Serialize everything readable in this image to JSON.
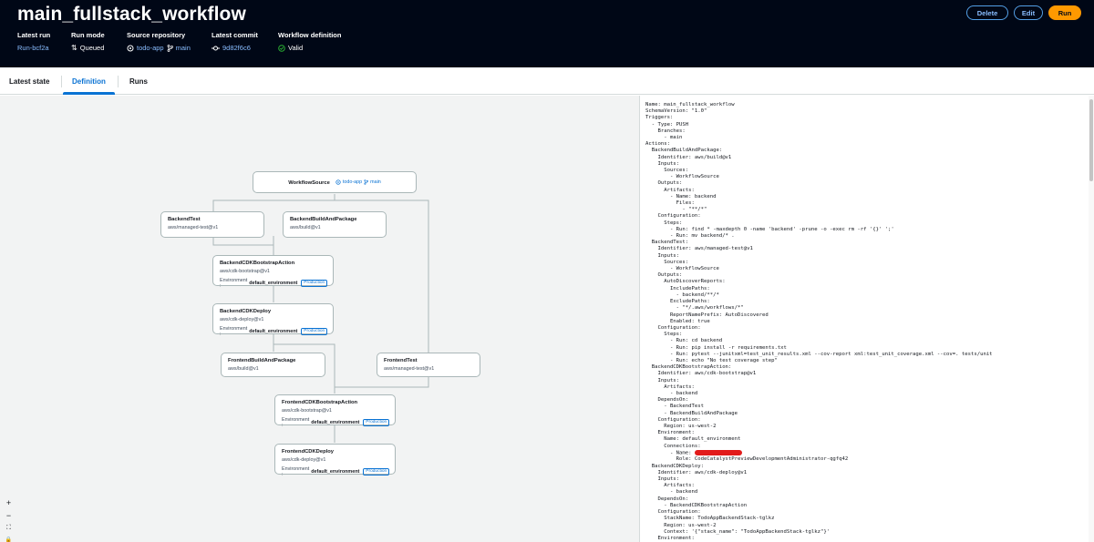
{
  "workflow": {
    "title": "main_fullstack_workflow",
    "latest_run": {
      "label": "Latest run",
      "value": "Run-bcf2a"
    },
    "run_mode": {
      "label": "Run mode",
      "value": "Queued"
    },
    "source_repository": {
      "label": "Source repository",
      "repo": "todo-app",
      "branch": "main"
    },
    "latest_commit": {
      "label": "Latest commit",
      "value": "9d82f6c6"
    },
    "workflow_definition": {
      "label": "Workflow definition",
      "value": "Valid"
    }
  },
  "actions": {
    "delete": "Delete",
    "edit": "Edit",
    "run": "Run"
  },
  "tabs": [
    "Latest state",
    "Definition",
    "Runs"
  ],
  "graph": {
    "source": {
      "name": "WorkflowSource",
      "repo": "todo-app",
      "branch": "main"
    },
    "env_label": "Environment :",
    "nodes": [
      {
        "name": "BackendTest",
        "id": "aws/managed-test@v1"
      },
      {
        "name": "BackendBuildAndPackage",
        "id": "aws/build@v1"
      },
      {
        "name": "BackendCDKBootstrapAction",
        "id": "aws/cdk-bootstrap@v1",
        "env": "default_environment",
        "badge": "Production"
      },
      {
        "name": "BackendCDKDeploy",
        "id": "aws/cdk-deploy@v1",
        "env": "default_environment",
        "badge": "Production"
      },
      {
        "name": "FrontendBuildAndPackage",
        "id": "aws/build@v1"
      },
      {
        "name": "FrontendTest",
        "id": "aws/managed-test@v1"
      },
      {
        "name": "FrontendCDKBootstrapAction",
        "id": "aws/cdk-bootstrap@v1",
        "env": "default_environment",
        "badge": "Production"
      },
      {
        "name": "FrontendCDKDeploy",
        "id": "aws/cdk-deploy@v1",
        "env": "default_environment",
        "badge": "Production"
      }
    ],
    "zoom_controls": [
      "+",
      "−",
      "⛶",
      "🔒"
    ]
  },
  "yaml_pre": "Name: main_fullstack_workflow\nSchemaVersion: \"1.0\"\nTriggers:\n  - Type: PUSH\n    Branches:\n      - main\nActions:\n  BackendBuildAndPackage:\n    Identifier: aws/build@v1\n    Inputs:\n      Sources:\n        - WorkflowSource\n    Outputs:\n      Artifacts:\n        - Name: backend\n          Files:\n            - \"**/*\"\n    Configuration:\n      Steps:\n        - Run: find * -maxdepth 0 -name 'backend' -prune -o -exec rm -rf '{}' ';'\n        - Run: mv backend/* .\n  BackendTest:\n    Identifier: aws/managed-test@v1\n    Inputs:\n      Sources:\n        - WorkflowSource\n    Outputs:\n      AutoDiscoverReports:\n        IncludePaths:\n          - backend/**/*\n        ExcludePaths:\n          - \"*/.aws/workflows/*\"\n        ReportNamePrefix: AutoDiscovered\n        Enabled: true\n    Configuration:\n      Steps:\n        - Run: cd backend\n        - Run: pip install -r requirements.txt\n        - Run: pytest --junitxml=test_unit_results.xml --cov-report xml:test_unit_coverage.xml --cov=. tests/unit\n        - Run: echo \"No test coverage step\"\n  BackendCDKBootstrapAction:\n    Identifier: aws/cdk-bootstrap@v1\n    Inputs:\n      Artifacts:\n        - backend\n    DependsOn:\n      - BackendTest\n      - BackendBuildAndPackage\n    Configuration:\n      Region: us-west-2\n    Environment:\n      Name: default_environment\n      Connections:\n        - Name: ",
  "yaml_post": "\n          Role: CodeCatalystPreviewDevelopmentAdministrator-qgfq42\n  BackendCDKDeploy:\n    Identifier: aws/cdk-deploy@v1\n    Inputs:\n      Artifacts:\n        - backend\n    DependsOn:\n      - BackendCDKBootstrapAction\n    Configuration:\n      StackName: TodoAppBackendStack-tglkz\n      Region: us-west-2\n      Context: '{\"stack_name\": \"TodoAppBackendStack-tglkz\"}'\n    Environment:"
}
